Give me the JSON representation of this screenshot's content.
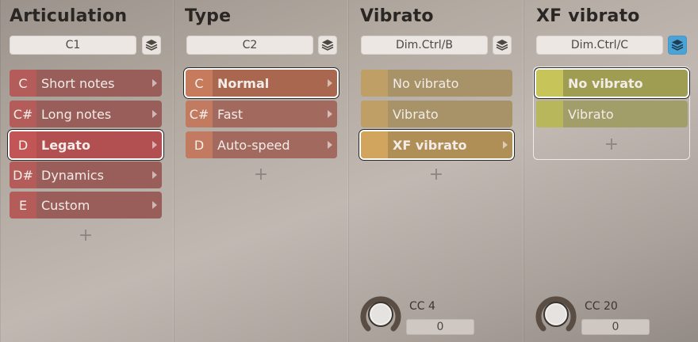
{
  "columns": [
    {
      "title": "Articulation",
      "selector": "C1",
      "items": [
        {
          "key": "C",
          "label": "Short notes"
        },
        {
          "key": "C#",
          "label": "Long notes"
        },
        {
          "key": "D",
          "label": "Legato"
        },
        {
          "key": "D#",
          "label": "Dynamics"
        },
        {
          "key": "E",
          "label": "Custom"
        }
      ],
      "add": "+"
    },
    {
      "title": "Type",
      "selector": "C2",
      "items": [
        {
          "key": "C",
          "label": "Normal"
        },
        {
          "key": "C#",
          "label": "Fast"
        },
        {
          "key": "D",
          "label": "Auto-speed"
        }
      ],
      "add": "+"
    },
    {
      "title": "Vibrato",
      "selector": "Dim.Ctrl/B",
      "items": [
        {
          "label": "No vibrato"
        },
        {
          "label": "Vibrato"
        },
        {
          "label": "XF vibrato"
        }
      ],
      "add": "+",
      "cc_label": "CC 4",
      "cc_value": "0"
    },
    {
      "title": "XF vibrato",
      "selector": "Dim.Ctrl/C",
      "items": [
        {
          "label": "No vibrato"
        },
        {
          "label": "Vibrato"
        }
      ],
      "add": "+",
      "cc_label": "CC 20",
      "cc_value": "0"
    }
  ],
  "icons": {
    "layers": "layers-icon",
    "arrow": "chevron-right-icon",
    "add": "plus-icon",
    "knob": "knob-icon"
  },
  "colors": {
    "articulation_item": "#9a5e5a",
    "articulation_key": "#b45c5a",
    "articulation_selected": "#b24f51",
    "type_item": "#a26a5e",
    "type_key": "#c27a60",
    "vibrato_item": "#a79367",
    "vibrato_key": "#bf9f66",
    "xf_item": "#a19e6a",
    "xf_key": "#b9b75c",
    "xf_selected": "#9e9d52",
    "layers_active": "#4aa3d6"
  }
}
